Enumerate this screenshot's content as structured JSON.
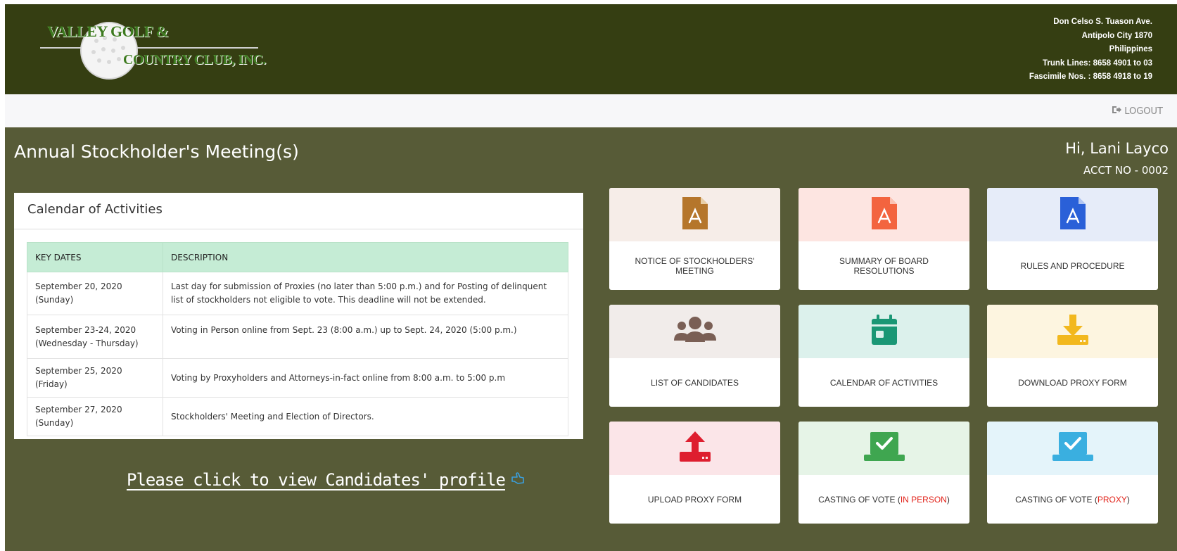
{
  "header": {
    "logo": {
      "line1": "VALLEY GOLF &",
      "line2": "COUNTRY CLUB, INC."
    },
    "address": [
      "Don Celso S. Tuason Ave.",
      "Antipolo City 1870",
      "Philippines",
      "Trunk Lines: 8658 4901 to 03",
      "Fascimile Nos. : 8658 4918 to 19"
    ],
    "colors": {
      "header_bg": "#353e12",
      "main_bg": "#575b37"
    }
  },
  "nav": {
    "logout_label": "LOGOUT",
    "logout_icon": "sign-out-icon"
  },
  "page": {
    "title": "Annual Stockholder's Meeting(s)",
    "greeting": "Hi, Lani Layco",
    "account": "ACCT NO - 0002"
  },
  "calendar": {
    "title": "Calendar of Activities",
    "headers": [
      "KEY DATES",
      "DESCRIPTION"
    ],
    "rows": [
      {
        "date": "September 20, 2020 (Sunday)",
        "description": "Last day for submission of Proxies (no later than 5:00 p.m.) and for Posting of delinquent list of stockholders not eligible to vote. This deadline will not be extended."
      },
      {
        "date": "September 23-24, 2020 (Wednesday - Thursday)",
        "description": "Voting in Person online from Sept. 23 (8:00 a.m.) up to Sept. 24, 2020 (5:00 p.m.)"
      },
      {
        "date": "September 25, 2020 (Friday)",
        "description": "Voting by Proxyholders and Attorneys-in-fact online from 8:00 a.m. to 5:00 p.m"
      },
      {
        "date": "September 27, 2020 (Sunday)",
        "description": "Stockholders' Meeting and Election of Directors."
      }
    ]
  },
  "candidates_link": {
    "label": "Please click to view Candidates' profile",
    "icon": "hand-pointer-icon"
  },
  "tiles": [
    {
      "label": "NOTICE OF STOCKHOLDERS' MEETING",
      "icon": "pdf-file-icon",
      "icon_color": "#b5762b",
      "bg": "#f6ede8"
    },
    {
      "label": "SUMMARY OF BOARD RESOLUTIONS",
      "icon": "pdf-file-icon",
      "icon_color": "#f3643f",
      "bg": "#fde5e1"
    },
    {
      "label": "RULES AND PROCEDURE",
      "icon": "pdf-file-icon",
      "icon_color": "#2a60d8",
      "bg": "#e6ecf9"
    },
    {
      "label": "LIST OF CANDIDATES",
      "icon": "users-icon",
      "icon_color": "#7a5f55",
      "bg": "#f1ecea"
    },
    {
      "label": "CALENDAR OF ACTIVITIES",
      "icon": "calendar-icon",
      "icon_color": "#1a9775",
      "bg": "#dcf1ec"
    },
    {
      "label": "DOWNLOAD PROXY FORM",
      "icon": "download-icon",
      "icon_color": "#f2b81e",
      "bg": "#fdf5e0"
    },
    {
      "label": "UPLOAD PROXY FORM",
      "icon": "upload-icon",
      "icon_color": "#de1e2f",
      "bg": "#fbe5e8"
    },
    {
      "label_prefix": "CASTING OF VOTE (",
      "label_highlight": "IN PERSON",
      "label_suffix": ")",
      "icon": "vote-check-icon",
      "icon_color": "#3fa650",
      "bg": "#e6f4e7",
      "highlight_color": "#e2231a"
    },
    {
      "label_prefix": "CASTING OF VOTE (",
      "label_highlight": "PROXY",
      "label_suffix": ")",
      "icon": "vote-check-icon",
      "icon_color": "#3aafe0",
      "bg": "#e4f4fa",
      "highlight_color": "#e2231a"
    }
  ]
}
